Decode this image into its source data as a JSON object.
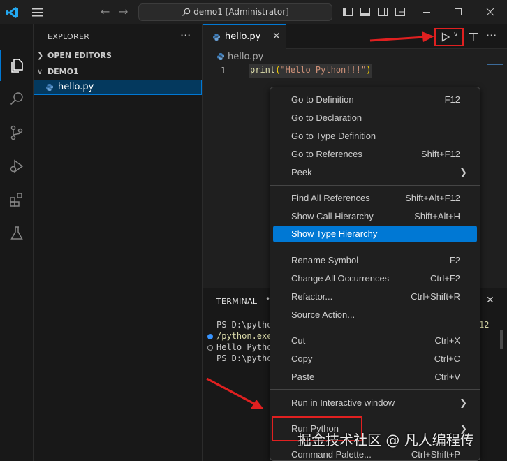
{
  "titlebar": {
    "search_text": "demo1 [Administrator]"
  },
  "sidebar": {
    "title": "EXPLORER",
    "open_editors_label": "OPEN EDITORS",
    "folder_label": "DEMO1",
    "files": [
      {
        "name": "hello.py"
      }
    ]
  },
  "editor": {
    "tab_label": "hello.py",
    "breadcrumb": "hello.py",
    "line_number": "1",
    "code": {
      "fn": "print",
      "open": "(",
      "str": "\"Hello Python!!!\"",
      "close": ")"
    }
  },
  "terminal": {
    "tab_label": "TERMINAL",
    "lines": [
      "PS D:\\pytho",
      "/python.exe",
      "Hello Pytho",
      "PS D:\\pytho"
    ],
    "right_fragment": "12"
  },
  "context_menu": {
    "items": [
      {
        "label": "Go to Definition",
        "shortcut": "F12"
      },
      {
        "label": "Go to Declaration",
        "shortcut": ""
      },
      {
        "label": "Go to Type Definition",
        "shortcut": ""
      },
      {
        "label": "Go to References",
        "shortcut": "Shift+F12"
      },
      {
        "label": "Peek",
        "shortcut": ""
      },
      {
        "label": "Find All References",
        "shortcut": "Shift+Alt+F12"
      },
      {
        "label": "Show Call Hierarchy",
        "shortcut": "Shift+Alt+H"
      },
      {
        "label": "Show Type Hierarchy",
        "shortcut": ""
      },
      {
        "label": "Rename Symbol",
        "shortcut": "F2"
      },
      {
        "label": "Change All Occurrences",
        "shortcut": "Ctrl+F2"
      },
      {
        "label": "Refactor...",
        "shortcut": "Ctrl+Shift+R"
      },
      {
        "label": "Source Action...",
        "shortcut": ""
      },
      {
        "label": "Cut",
        "shortcut": "Ctrl+X"
      },
      {
        "label": "Copy",
        "shortcut": "Ctrl+C"
      },
      {
        "label": "Paste",
        "shortcut": "Ctrl+V"
      },
      {
        "label": "Run in Interactive window",
        "shortcut": ""
      },
      {
        "label": "Run Python",
        "shortcut": ""
      },
      {
        "label": "Command Palette...",
        "shortcut": "Ctrl+Shift+P"
      }
    ],
    "highlighted_index": 7
  },
  "watermark": "掘金技术社区 @ 凡人编程传",
  "colors": {
    "accent": "#0078d4",
    "annotation_red": "#e02020"
  }
}
